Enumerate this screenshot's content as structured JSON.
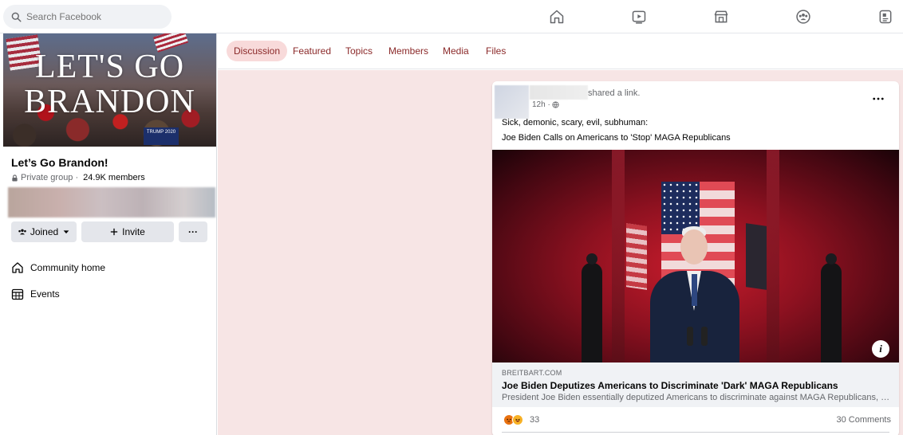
{
  "search": {
    "placeholder": "Search Facebook"
  },
  "nav": {
    "icons": [
      "home-icon",
      "watch-icon",
      "marketplace-icon",
      "groups-icon",
      "gaming-icon"
    ]
  },
  "group": {
    "cover_text": "LET'S GO BRANDON",
    "cover_sign": "TRUMP 2020",
    "name": "Let’s Go Brandon!",
    "privacy": "Private group",
    "separator": "·",
    "members": "24.9K members",
    "joined_label": "Joined",
    "invite_label": "Invite",
    "more_label": "···"
  },
  "sidebar": {
    "items": [
      {
        "label": "Community home",
        "icon": "home-icon"
      },
      {
        "label": "Events",
        "icon": "calendar-icon"
      }
    ]
  },
  "tabs": [
    {
      "label": "Discussion",
      "active": true
    },
    {
      "label": "Featured",
      "active": false
    },
    {
      "label": "Topics",
      "active": false
    },
    {
      "label": "Members",
      "active": false
    },
    {
      "label": "Media",
      "active": false
    },
    {
      "label": "Files",
      "active": false
    }
  ],
  "post": {
    "action": "shared a link.",
    "time": "12h ·",
    "text_line1": "Sick, demonic, scary, evil, subhuman:",
    "text_line2": "Joe Biden Calls on Americans to 'Stop' MAGA Republicans",
    "more_label": "···",
    "info_label": "i",
    "link": {
      "domain": "BREITBART.COM",
      "title": "Joe Biden Deputizes Americans to Discriminate 'Dark' MAGA Republicans",
      "description": "President Joe Biden essentially deputized Americans to discriminate against MAGA Republicans, who..."
    },
    "reactions": {
      "count": "33",
      "types": [
        "angry",
        "haha"
      ]
    },
    "comments": "30 Comments"
  },
  "colors": {
    "tab_active_bg": "#f8dada",
    "tab_text": "#8b2a2a",
    "main_bg": "#f7e5e5"
  }
}
